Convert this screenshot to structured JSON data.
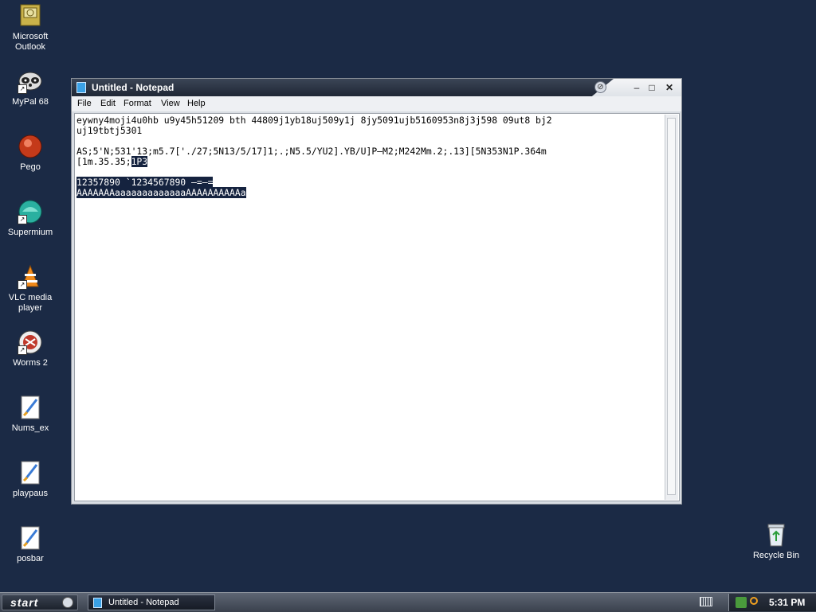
{
  "desktop": {
    "icons": [
      {
        "label": "Microsoft Outlook"
      },
      {
        "label": "MyPal 68"
      },
      {
        "label": "Pego"
      },
      {
        "label": "Supermium"
      },
      {
        "label": "VLC media player"
      },
      {
        "label": "Worms 2"
      },
      {
        "label": "Nums_ex"
      },
      {
        "label": "playpaus"
      },
      {
        "label": "posbar"
      },
      {
        "label": "Recycle Bin"
      }
    ]
  },
  "window": {
    "title": "Untitled - Notepad",
    "menu": [
      "File",
      "Edit",
      "Format",
      "View",
      "Help"
    ],
    "text": {
      "line1": "eywny4moji4u0hb u9y45h51209 bth 44809j1yb18uj509y1j 8jy5091ujb5160953n8j3j598 09ut8 bj2",
      "line2": "uj19tbtj5301",
      "line3": "",
      "line4": "AS;5'N;531'13;m5.7['./27;5N13/5/17]1;.;N5.5/YU2].YB/U]P–M2;M242Mm.2;.13][5N353N1P.364m",
      "line5_plain": "[1m.35.35;",
      "line5_selected": "1P3",
      "line6": "",
      "line7_selected": "12357890 `1234567890 –=–=",
      "line8_selected": "AAAAAAAaaaaaaaaaaaaaAAAAAAAAAAa"
    }
  },
  "taskbar": {
    "start_label": "start",
    "task_label": "Untitled - Notepad",
    "clock": "5:31 PM"
  }
}
